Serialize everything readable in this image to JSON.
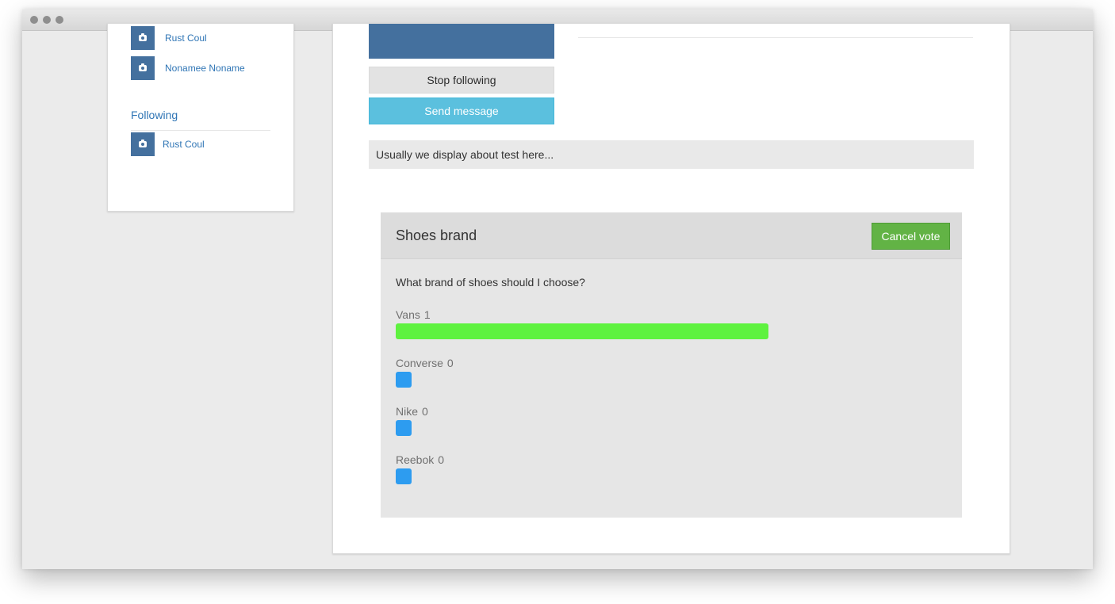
{
  "sidebar": {
    "followers": [
      {
        "name": "Rust Coul"
      },
      {
        "name": "Nonamee Noname"
      }
    ],
    "following_title": "Following",
    "following": [
      {
        "name": "Rust Coul"
      }
    ]
  },
  "profile": {
    "stop_following_label": "Stop following",
    "send_message_label": "Send message",
    "about_text": "Usually we display about test here..."
  },
  "poll": {
    "title": "Shoes brand",
    "cancel_vote_label": "Cancel vote",
    "question": "What brand of shoes should I choose?",
    "options": [
      {
        "label": "Vans",
        "count": "1",
        "share": 1.0,
        "color": "#5ef23f"
      },
      {
        "label": "Converse",
        "count": "0",
        "share": 0.0,
        "color": "#2d9cf0"
      },
      {
        "label": "Nike",
        "count": "0",
        "share": 0.0,
        "color": "#2d9cf0"
      },
      {
        "label": "Reebok",
        "count": "0",
        "share": 0.0,
        "color": "#2d9cf0"
      }
    ]
  },
  "colors": {
    "brand_blue": "#44709e",
    "link_blue": "#2f75b5",
    "info": "#5bc0de",
    "success": "#62b345"
  }
}
